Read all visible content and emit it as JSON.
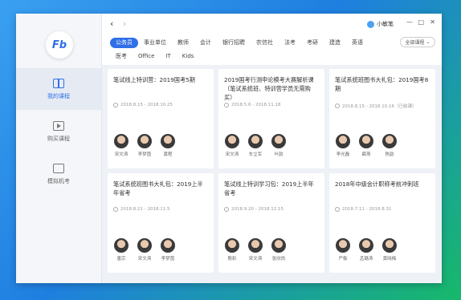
{
  "app": {
    "logo_text": "Fb",
    "user_name": "小敏笔",
    "controls": [
      "—",
      "□",
      "✕"
    ]
  },
  "sidebar": {
    "items": [
      {
        "label": "我的课程",
        "icon": "book-icon",
        "active": true
      },
      {
        "label": "购买课程",
        "icon": "video-icon",
        "active": false
      },
      {
        "label": "模拟机考",
        "icon": "exam-icon",
        "active": false
      }
    ]
  },
  "tabs": {
    "row1": [
      "公务员",
      "事业单位",
      "教师",
      "会计",
      "银行招聘",
      "农信社",
      "法考",
      "考研",
      "建造",
      "英语"
    ],
    "row2": [
      "医考",
      "Office",
      "IT",
      "Kids"
    ],
    "select_label": "全部课程"
  },
  "courses": [
    {
      "title": "笔试线上特训营：2019国考5期",
      "date": "2018.8.15 - 2018.10.25",
      "teachers": [
        "宋文涛",
        "李梦茵",
        "黄程"
      ]
    },
    {
      "title": "2019国考行测申论模考大赛解析课（笔试系统班、特训营学员无需购买）",
      "date": "2018.5.6 - 2018.11.18",
      "teachers": [
        "宋文涛",
        "车立军",
        "叶韵"
      ]
    },
    {
      "title": "笔试系统班图书大礼包：2019国考8期",
      "date": "2018.8.15 - 2018.10.16（已结课）",
      "teachers": [
        "李光磊",
        "薛燕",
        "陈韵"
      ]
    },
    {
      "title": "笔试系统班图书大礼包：2019上半年省考",
      "date": "2018.8.21 - 2018.11.5",
      "teachers": [
        "唐宗",
        "宋文涛",
        "李梦茵"
      ]
    },
    {
      "title": "笔试线上特训学习包：2019上半年省考",
      "date": "2018.9.20 - 2018.12.15",
      "teachers": [
        "殷彩",
        "宋文涛",
        "张欣尚"
      ]
    },
    {
      "title": "2018年中级会计职称考前冲刺班",
      "date": "2018.7.11 - 2018.8.31",
      "teachers": [
        "严衡",
        "孟璐涛",
        "黄晓梅"
      ]
    }
  ]
}
